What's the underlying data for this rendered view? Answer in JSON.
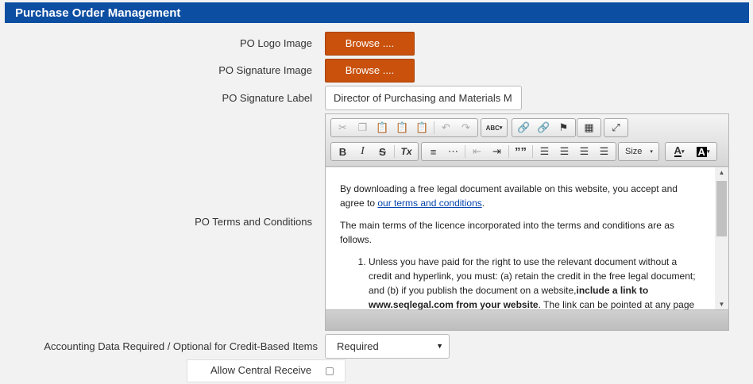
{
  "section": {
    "title": "Purchase Order Management"
  },
  "fields": {
    "po_logo": {
      "label": "PO Logo Image",
      "button": "Browse ...."
    },
    "po_signature": {
      "label": "PO Signature Image",
      "button": "Browse ...."
    },
    "po_signature_label": {
      "label": "PO Signature Label",
      "value": "Director of Purchasing and Materials M"
    },
    "po_terms": {
      "label": "PO Terms and Conditions"
    },
    "accounting": {
      "label": "Accounting Data Required / Optional for Credit-Based Items",
      "selected": "Required"
    },
    "central_receive": {
      "label": "Allow Central Receive",
      "checked": false
    }
  },
  "editor": {
    "toolbar": {
      "row1": [
        "cut-icon",
        "copy-icon",
        "paste-icon",
        "paste-text-icon",
        "paste-word-icon",
        "undo-icon",
        "redo-icon",
        "spellcheck-icon",
        "link-icon",
        "unlink-icon",
        "anchor-icon",
        "table-icon",
        "maximize-icon"
      ],
      "spell_label": "ABC",
      "bold": "B",
      "italic": "I",
      "strike": "S",
      "clear_format": "Tx",
      "blockquote": "””",
      "size_label": "Size",
      "font_color": "A",
      "bg_color": "A"
    },
    "content": {
      "p1_text": "By downloading a free legal document available on this website, you accept and agree to ",
      "p1_link": "our terms and conditions",
      "p1_end": ".",
      "p2": "The main terms of the licence incorporated into the terms and conditions are as follows.",
      "li1_text": "Unless you have paid for the right to use the relevant document without a credit and hyperlink, you must: (a) retain the credit in the free legal document; and (b) if you publish the document on a website,",
      "li1_bold": "include a link to www.seqlegal.com from your website",
      "li1_end": ".  The link can be pointed at any page on www.seqlegal.com."
    }
  }
}
